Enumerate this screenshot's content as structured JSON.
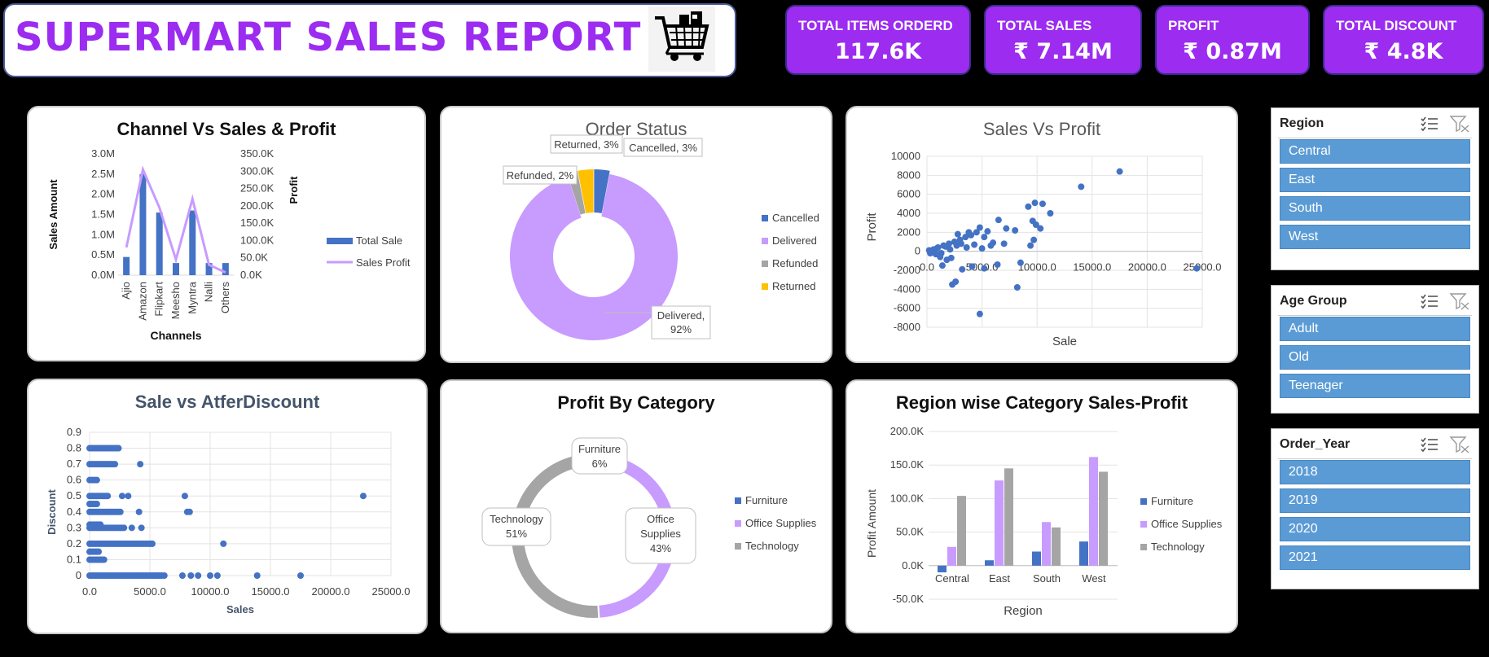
{
  "header": {
    "title": "SUPERMART SALES REPORT",
    "logo_icon": "shopping-cart-icon"
  },
  "kpis": [
    {
      "label": "TOTAL ITEMS ORDERD",
      "value": "117.6K"
    },
    {
      "label": "TOTAL SALES",
      "value": "₹ 7.14M"
    },
    {
      "label": "PROFIT",
      "value": "₹ 0.87M"
    },
    {
      "label": "TOTAL DISCOUNT",
      "value": "₹ 4.8K"
    }
  ],
  "colors": {
    "purple": "#9b2cf0",
    "blue": "#4472c4",
    "lavender": "#c89bff",
    "gray": "#a5a5a5",
    "gold": "#ffc000",
    "slicer_blue": "#5b9bd5"
  },
  "slicers": [
    {
      "title": "Region",
      "items": [
        "Central",
        "East",
        "South",
        "West"
      ]
    },
    {
      "title": "Age Group",
      "items": [
        "Adult",
        "Old",
        "Teenager"
      ]
    },
    {
      "title": "Order_Year",
      "items": [
        "2018",
        "2019",
        "2020",
        "2021"
      ]
    }
  ],
  "chart_data": [
    {
      "title": "Channel Vs Sales & Profit",
      "type": "bar",
      "xlabel": "Channels",
      "ylabel": "Sales Amount",
      "y2label": "Profit",
      "categories": [
        "Ajio",
        "Amazon",
        "Flipkart",
        "Meesho",
        "Myntra",
        "Nalli",
        "Others"
      ],
      "series": [
        {
          "name": "Total Sale",
          "type": "bar",
          "axis": "left",
          "values": [
            0.45,
            2.5,
            1.55,
            0.3,
            1.6,
            0.3,
            0.3
          ]
        },
        {
          "name": "Sales Profit",
          "type": "line",
          "axis": "right",
          "values": [
            80,
            305,
            195,
            45,
            220,
            30,
            8
          ]
        }
      ],
      "ylim": [
        0,
        3.0
      ],
      "y2lim": [
        0,
        350
      ],
      "yticks": [
        "0.0M",
        "0.5M",
        "1.0M",
        "1.5M",
        "2.0M",
        "2.5M",
        "3.0M"
      ],
      "y2ticks": [
        "0.0K",
        "50.0K",
        "100.0K",
        "150.0K",
        "200.0K",
        "250.0K",
        "300.0K",
        "350.0K"
      ]
    },
    {
      "title": "Order Status",
      "type": "pie",
      "donut": true,
      "slices": [
        {
          "label": "Cancelled",
          "value": 3,
          "text": "Cancelled, 3%"
        },
        {
          "label": "Delivered",
          "value": 92,
          "text": "Delivered, 92%"
        },
        {
          "label": "Refunded",
          "value": 2,
          "text": "Refunded, 2%"
        },
        {
          "label": "Returned",
          "value": 3,
          "text": "Returned, 3%"
        }
      ]
    },
    {
      "title": "Sales Vs Profit",
      "type": "scatter",
      "xlabel": "Sale",
      "ylabel": "Profit",
      "xlim": [
        0,
        25000
      ],
      "ylim": [
        -8000,
        10000
      ],
      "xticks": [
        "0.0",
        "5000.0",
        "10000.0",
        "15000.0",
        "20000.0",
        "25000.0"
      ],
      "yticks": [
        "-8000",
        "-6000",
        "-4000",
        "-2000",
        "0",
        "2000",
        "4000",
        "6000",
        "8000",
        "10000"
      ],
      "points": [
        [
          17500,
          8400
        ],
        [
          14000,
          6800
        ],
        [
          10500,
          5000
        ],
        [
          9800,
          5100
        ],
        [
          9200,
          4700
        ],
        [
          11200,
          4000
        ],
        [
          9600,
          3200
        ],
        [
          9900,
          2800
        ],
        [
          10300,
          2400
        ],
        [
          6500,
          3300
        ],
        [
          7200,
          2400
        ],
        [
          8000,
          2200
        ],
        [
          4800,
          2500
        ],
        [
          5500,
          2100
        ],
        [
          3800,
          2000
        ],
        [
          2800,
          1800
        ],
        [
          9700,
          1200
        ],
        [
          9400,
          600
        ],
        [
          8500,
          -1200
        ],
        [
          8200,
          -3800
        ],
        [
          4800,
          -6600
        ],
        [
          1400,
          -1500
        ],
        [
          2300,
          -3500
        ],
        [
          2600,
          -3200
        ],
        [
          3200,
          -1900
        ],
        [
          4100,
          -1600
        ],
        [
          5200,
          -1800
        ],
        [
          6400,
          -1400
        ],
        [
          600,
          200
        ],
        [
          1000,
          400
        ],
        [
          1500,
          600
        ],
        [
          2000,
          800
        ],
        [
          2500,
          1000
        ],
        [
          3000,
          1200
        ],
        [
          3500,
          1500
        ],
        [
          4000,
          1700
        ],
        [
          4500,
          2000
        ],
        [
          5200,
          1500
        ],
        [
          6000,
          900
        ],
        [
          300,
          -200
        ],
        [
          800,
          -300
        ],
        [
          1200,
          -600
        ],
        [
          1800,
          -900
        ],
        [
          2200,
          -700
        ],
        [
          200,
          100
        ],
        [
          500,
          -100
        ],
        [
          900,
          300
        ],
        [
          1300,
          -200
        ],
        [
          1700,
          500
        ],
        [
          2100,
          200
        ],
        [
          2700,
          600
        ],
        [
          3100,
          800
        ],
        [
          3600,
          400
        ],
        [
          4300,
          700
        ],
        [
          5000,
          300
        ],
        [
          5800,
          600
        ],
        [
          7000,
          800
        ],
        [
          24500,
          -1800
        ]
      ]
    },
    {
      "title": "Sale vs  AtferDiscount",
      "type": "scatter",
      "xlabel": "Sales",
      "ylabel": "Discount",
      "xlim": [
        0,
        25000
      ],
      "ylim": [
        0,
        0.9
      ],
      "xticks": [
        "0.0",
        "5000.0",
        "10000.0",
        "15000.0",
        "20000.0",
        "25000.0"
      ],
      "yticks": [
        "0",
        "0.1",
        "0.2",
        "0.3",
        "0.4",
        "0.5",
        "0.6",
        "0.7",
        "0.8",
        "0.9"
      ],
      "points": [
        [
          22700,
          0.5
        ],
        [
          11100,
          0.2
        ],
        [
          4200,
          0.7
        ],
        [
          7900,
          0.5
        ],
        [
          8100,
          0.4
        ],
        [
          8300,
          0.4
        ],
        [
          4100,
          0.4
        ],
        [
          4300,
          0.3
        ],
        [
          13900,
          0
        ],
        [
          17500,
          0
        ],
        [
          9000,
          0
        ],
        [
          10000,
          0
        ],
        [
          10600,
          0
        ],
        [
          8400,
          0
        ],
        [
          7700,
          0
        ],
        [
          6200,
          0
        ],
        [
          5600,
          0
        ],
        [
          3200,
          0.5
        ],
        [
          2700,
          0.5
        ],
        [
          5200,
          0.2
        ],
        [
          3500,
          0.3
        ]
      ],
      "bands": [
        {
          "y": 0,
          "max": 6000
        },
        {
          "y": 0.1,
          "max": 1300
        },
        {
          "y": 0.15,
          "max": 800
        },
        {
          "y": 0.2,
          "max": 5200
        },
        {
          "y": 0.3,
          "max": 2900
        },
        {
          "y": 0.32,
          "max": 900
        },
        {
          "y": 0.4,
          "max": 2600
        },
        {
          "y": 0.45,
          "max": 600
        },
        {
          "y": 0.5,
          "max": 1600
        },
        {
          "y": 0.6,
          "max": 700
        },
        {
          "y": 0.7,
          "max": 2100
        },
        {
          "y": 0.8,
          "max": 2400
        }
      ]
    },
    {
      "title": "Profit By Category",
      "type": "pie",
      "donut": true,
      "slices": [
        {
          "label": "Furniture",
          "value": 6,
          "text": "Furniture 6%"
        },
        {
          "label": "Office Supplies",
          "value": 43,
          "text": "Office Supplies 43%"
        },
        {
          "label": "Technology",
          "value": 51,
          "text": "Technology 51%"
        }
      ]
    },
    {
      "title": "Region wise Category Sales-Profit",
      "type": "bar",
      "xlabel": "Region",
      "ylabel": "Profit Amount",
      "categories": [
        "Central",
        "East",
        "South",
        "West"
      ],
      "series": [
        {
          "name": "Furniture",
          "values": [
            -10,
            8,
            21,
            36
          ]
        },
        {
          "name": "Office Supplies",
          "values": [
            28,
            127,
            65,
            162
          ]
        },
        {
          "name": "Technology",
          "values": [
            104,
            145,
            57,
            140
          ]
        }
      ],
      "ylim": [
        -50,
        200
      ],
      "yticks": [
        "-50.0K",
        "0.0K",
        "50.0K",
        "100.0K",
        "150.0K",
        "200.0K"
      ]
    }
  ]
}
